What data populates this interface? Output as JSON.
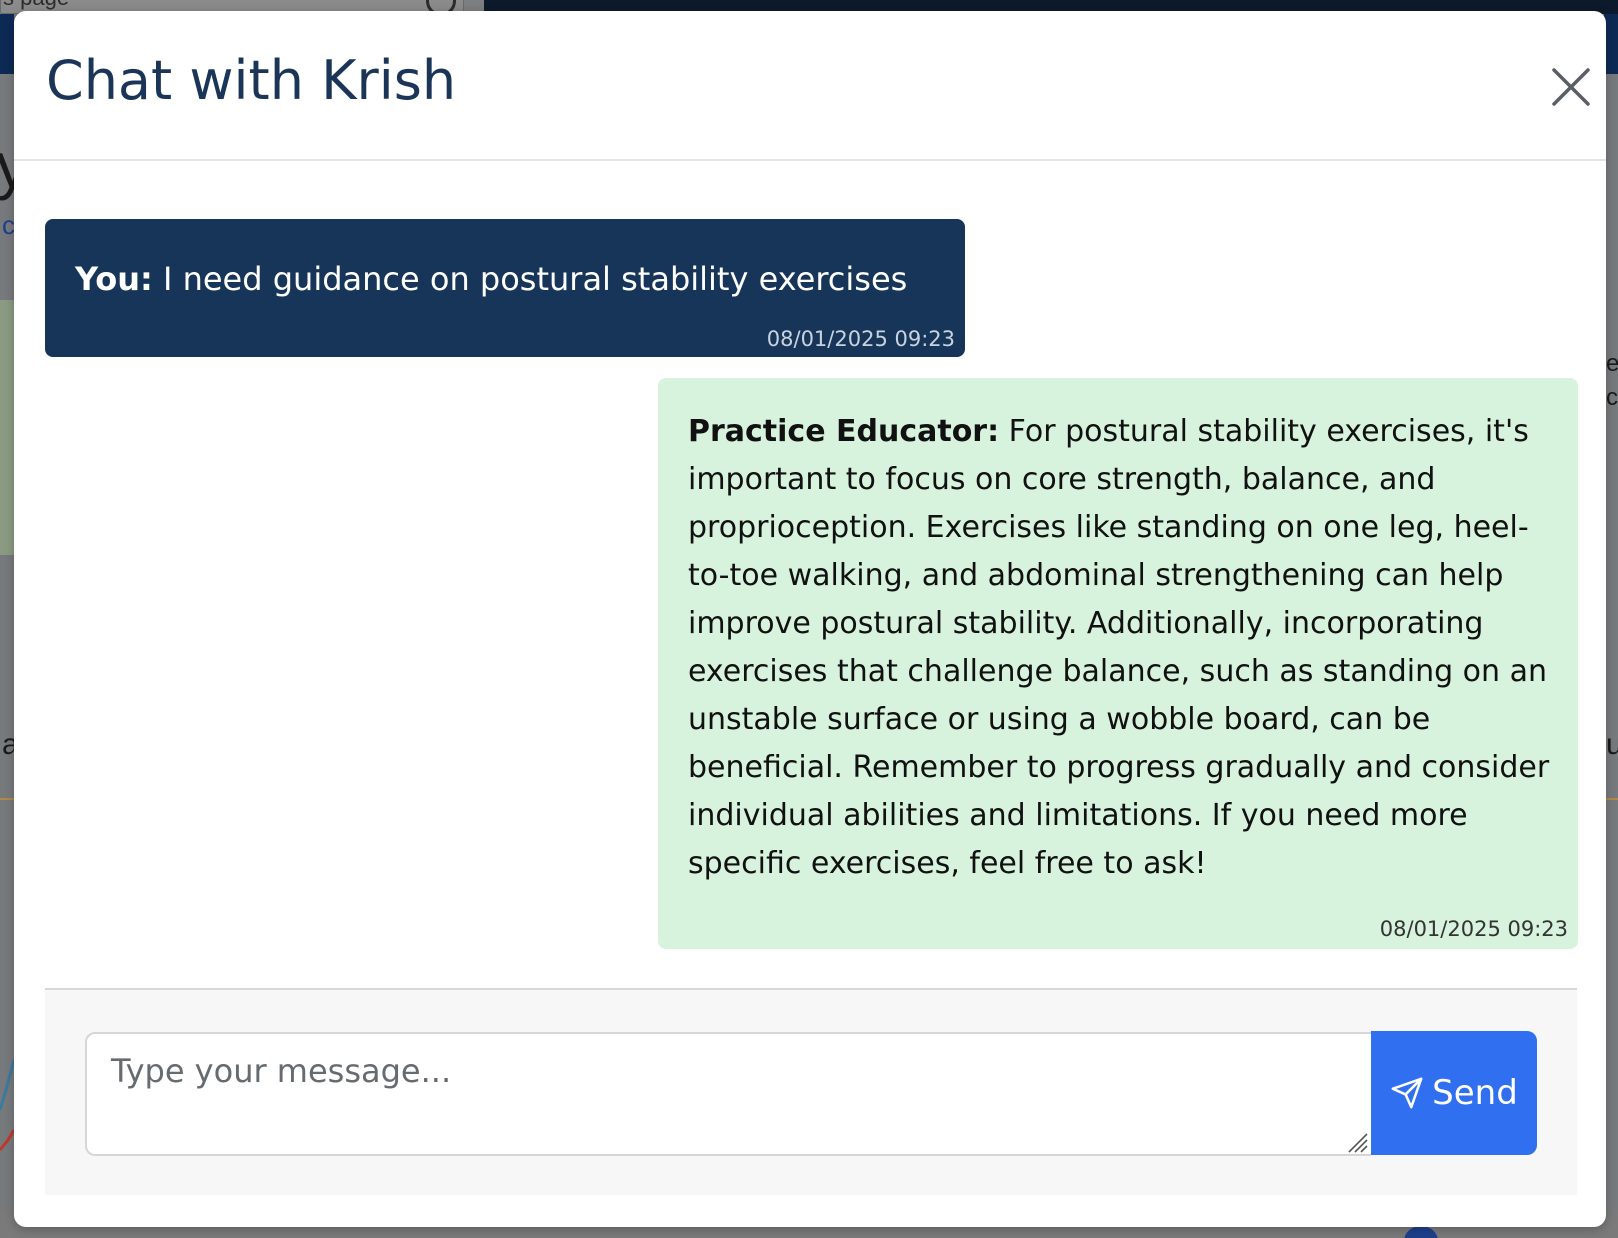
{
  "background": {
    "search_fragment": "s page",
    "fragments": [
      "y",
      "c",
      "a",
      "e",
      "c",
      "u"
    ]
  },
  "modal": {
    "title": "Chat with Krish",
    "close_icon": "close-icon"
  },
  "messages": [
    {
      "role": "user",
      "sender": "You:",
      "text": "I need guidance on postural stability exercises",
      "timestamp": "08/01/2025 09:23"
    },
    {
      "role": "assistant",
      "sender": "Practice Educator:",
      "text": "For postural stability exercises, it's important to focus on core strength, balance, and proprioception. Exercises like standing on one leg, heel-to-toe walking, and abdominal strengthening can help improve postural stability. Additionally, incorporating exercises that challenge balance, such as standing on an unstable surface or using a wobble board, can be beneficial. Remember to progress gradually and consider individual abilities and limitations. If you need more specific exercises, feel free to ask!",
      "timestamp": "08/01/2025 09:23"
    }
  ],
  "composer": {
    "placeholder": "Type your message...",
    "value": "",
    "send_label": "Send",
    "send_icon": "paper-plane-icon"
  },
  "colors": {
    "title": "#1a3557",
    "user_bubble": "#163559",
    "assistant_bubble": "#d7f2dd",
    "send_button": "#2f6ff0"
  }
}
